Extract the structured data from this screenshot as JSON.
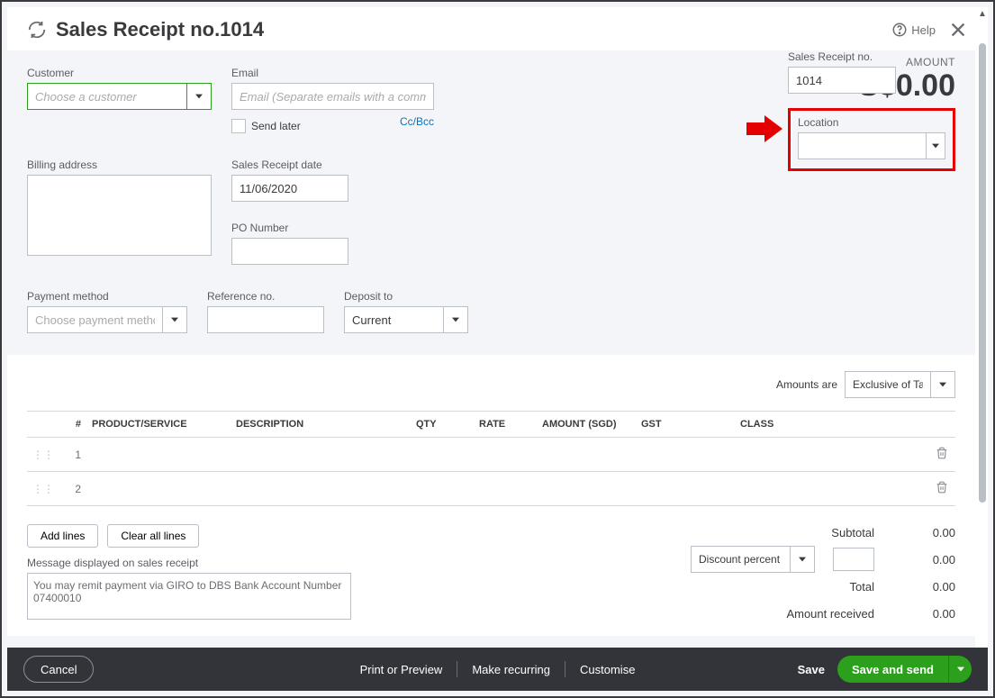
{
  "header": {
    "title": "Sales Receipt no.1014",
    "help": "Help"
  },
  "customer": {
    "label": "Customer",
    "placeholder": "Choose a customer",
    "value": ""
  },
  "email": {
    "label": "Email",
    "placeholder": "Email (Separate emails with a comma)",
    "value": "",
    "send_later": "Send later",
    "ccbcc": "Cc/Bcc"
  },
  "amount": {
    "label": "AMOUNT",
    "value": "S$0.00"
  },
  "billing": {
    "label": "Billing address",
    "value": ""
  },
  "receipt_date": {
    "label": "Sales Receipt date",
    "value": "11/06/2020"
  },
  "po": {
    "label": "PO Number",
    "value": ""
  },
  "receipt_no": {
    "label": "Sales Receipt no.",
    "value": "1014"
  },
  "location": {
    "label": "Location",
    "value": ""
  },
  "payment_method": {
    "label": "Payment method",
    "placeholder": "Choose payment method",
    "value": ""
  },
  "reference": {
    "label": "Reference no.",
    "value": ""
  },
  "deposit_to": {
    "label": "Deposit to",
    "value": "Current"
  },
  "amounts_are": {
    "label": "Amounts are",
    "value": "Exclusive of Tax"
  },
  "table": {
    "headers": {
      "num": "#",
      "product": "PRODUCT/SERVICE",
      "desc": "DESCRIPTION",
      "qty": "QTY",
      "rate": "RATE",
      "amount": "AMOUNT (SGD)",
      "gst": "GST",
      "class": "CLASS"
    },
    "rows": [
      {
        "num": "1"
      },
      {
        "num": "2"
      }
    ],
    "add_lines": "Add lines",
    "clear_all": "Clear all lines"
  },
  "message": {
    "label": "Message displayed on sales receipt",
    "value": "You may remit payment via GIRO to DBS Bank Account Number 07400010"
  },
  "discount": {
    "label": "Discount percent",
    "value": ""
  },
  "totals": {
    "subtotal_lbl": "Subtotal",
    "subtotal": "0.00",
    "discount_val": "0.00",
    "total_lbl": "Total",
    "total": "0.00",
    "received_lbl": "Amount received",
    "received": "0.00"
  },
  "footer": {
    "cancel": "Cancel",
    "print": "Print or Preview",
    "recurring": "Make recurring",
    "customise": "Customise",
    "save": "Save",
    "save_send": "Save and send"
  }
}
